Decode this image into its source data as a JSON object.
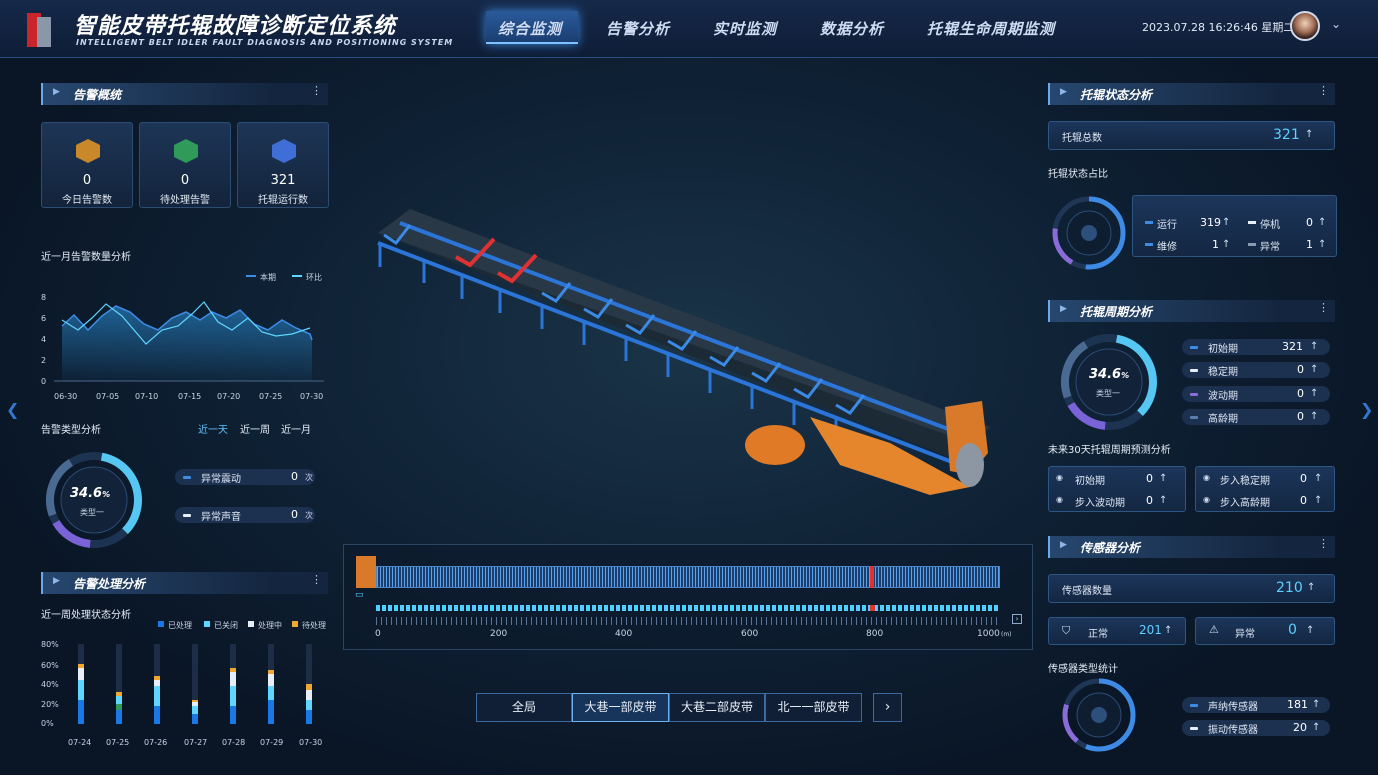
{
  "header": {
    "title_cn": "智能皮带托辊故障诊断定位系统",
    "title_en": "INTELLIGENT BELT IDLER FAULT DIAGNOSIS AND POSITIONING SYSTEM",
    "nav": [
      "综合监测",
      "告警分析",
      "实时监测",
      "数据分析",
      "托辊生命周期监测"
    ],
    "active_nav": "综合监测",
    "datetime": "2023.07.28 16:26:46  星期二"
  },
  "alarm_overview": {
    "title": "告警概统",
    "cards": [
      {
        "value": "0",
        "label": "今日告警数",
        "icon": "warning-icon",
        "color": "#c9882a"
      },
      {
        "value": "0",
        "label": "待处理告警",
        "icon": "clipboard-icon",
        "color": "#2f9a59"
      },
      {
        "value": "321",
        "label": "托辊运行数",
        "icon": "chart-icon",
        "color": "#3f6fd6"
      }
    ]
  },
  "monthly_chart": {
    "title": "近一月告警数量分析",
    "legend": [
      "本期",
      "环比"
    ],
    "y_ticks": [
      "8",
      "6",
      "4",
      "2",
      "0"
    ],
    "x_ticks": [
      "06-30",
      "07-05",
      "07-10",
      "07-15",
      "07-20",
      "07-25",
      "07-30"
    ]
  },
  "alarm_type": {
    "title": "告警类型分析",
    "tabs": [
      "近一天",
      "近一周",
      "近一月"
    ],
    "active_tab": "近一天",
    "percent": "34.6",
    "percent_unit": "%",
    "center_label": "类型一",
    "rows": [
      {
        "name": "异常震动",
        "value": "0",
        "unit": "次",
        "color": "#3e8be6"
      },
      {
        "name": "异常声音",
        "value": "0",
        "unit": "次",
        "color": "#e6eef8"
      }
    ]
  },
  "alarm_handling": {
    "title": "告警处理分析",
    "subtitle": "近一周处理状态分析",
    "legend": [
      {
        "name": "已处理",
        "color": "#1a78e6"
      },
      {
        "name": "已关闭",
        "color": "#5fd6ff"
      },
      {
        "name": "处理中",
        "color": "#e8eef8"
      },
      {
        "name": "待处理",
        "color": "#f0a830"
      }
    ],
    "y_ticks": [
      "80%",
      "60%",
      "40%",
      "20%",
      "0%"
    ],
    "x_ticks": [
      "07-24",
      "07-25",
      "07-26",
      "07-27",
      "07-28",
      "07-29",
      "07-30"
    ]
  },
  "map": {
    "ticks": [
      "0",
      "200",
      "400",
      "600",
      "800",
      "1000"
    ],
    "unit": "(m)"
  },
  "belts": {
    "buttons": [
      "全局",
      "大巷一部皮带",
      "大巷二部皮带",
      "北一一部皮带"
    ],
    "active": "大巷一部皮带",
    "next": "›"
  },
  "idler_status": {
    "title": "托辊状态分析",
    "total_label": "托辊总数",
    "total": "321",
    "ratio_label": "托辊状态占比",
    "items": [
      {
        "name": "运行",
        "value": "319",
        "color": "#3e8be6"
      },
      {
        "name": "停机",
        "value": "0",
        "color": "#e6eef8"
      },
      {
        "name": "维修",
        "value": "1",
        "color": "#3e8be6"
      },
      {
        "name": "异常",
        "value": "1",
        "color": "#8a9ab3"
      }
    ]
  },
  "idler_cycle": {
    "title": "托辊周期分析",
    "percent": "34.6",
    "percent_unit": "%",
    "center_label": "类型一",
    "rows": [
      {
        "name": "初始期",
        "value": "321",
        "color": "#3e8be6"
      },
      {
        "name": "稳定期",
        "value": "0",
        "color": "#e6eef8"
      },
      {
        "name": "波动期",
        "value": "0",
        "color": "#8a6bd8"
      },
      {
        "name": "高龄期",
        "value": "0",
        "color": "#5b7fae"
      }
    ],
    "forecast_title": "未来30天托辊周期预测分析",
    "forecast": [
      {
        "name": "初始期",
        "value": "0"
      },
      {
        "name": "步入稳定期",
        "value": "0"
      },
      {
        "name": "步入波动期",
        "value": "0"
      },
      {
        "name": "步入高龄期",
        "value": "0"
      }
    ]
  },
  "sensor": {
    "title": "传感器分析",
    "count_label": "传感器数量",
    "count": "210",
    "normal_label": "正常",
    "normal": "201",
    "abnormal_label": "异常",
    "abnormal": "0",
    "type_title": "传感器类型统计",
    "types": [
      {
        "name": "声纳传感器",
        "value": "181",
        "color": "#3e8be6"
      },
      {
        "name": "振动传感器",
        "value": "20",
        "color": "#e6eef8"
      }
    ]
  }
}
